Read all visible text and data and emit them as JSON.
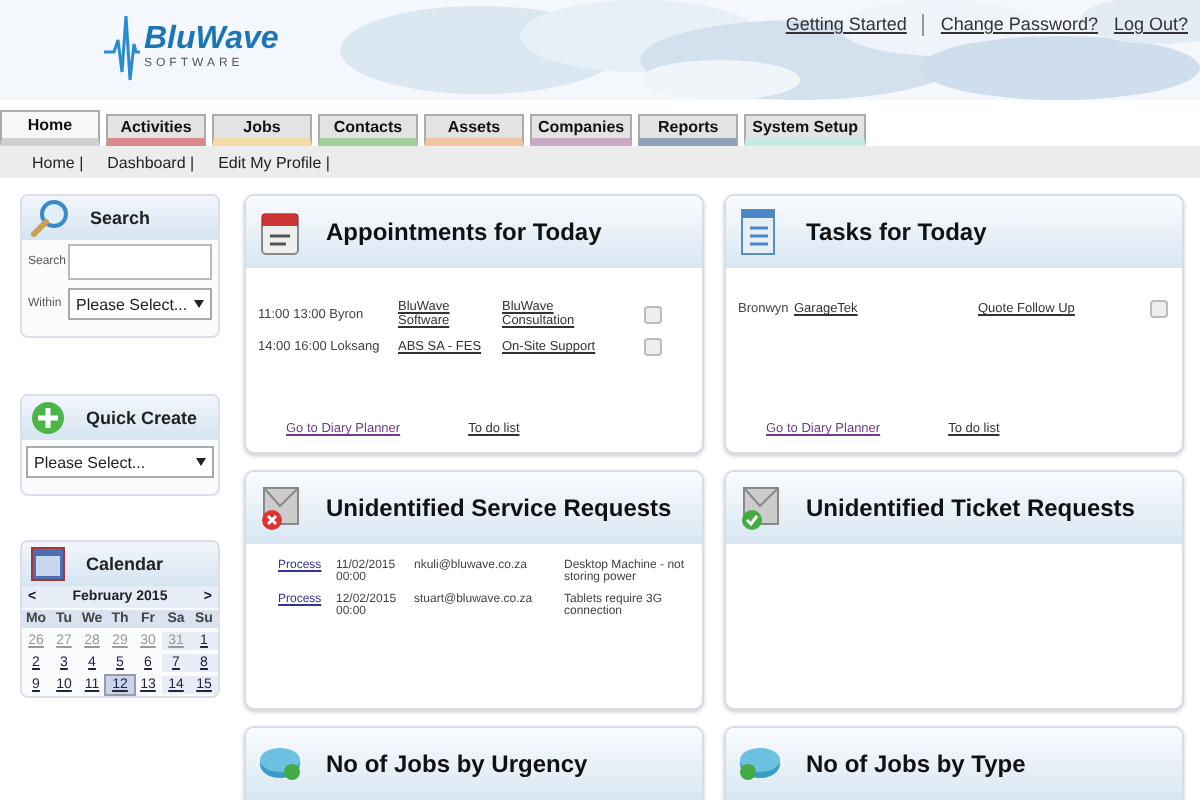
{
  "header": {
    "logo": {
      "name": "BluWave",
      "tagline": "SOFTWARE"
    },
    "links": [
      "Getting Started",
      "Change Password?",
      "Log Out?"
    ]
  },
  "tabs": [
    {
      "label": "Home",
      "selected": true,
      "color": "#d0d0d0"
    },
    {
      "label": "Activities",
      "selected": false,
      "color": "#d98a8a"
    },
    {
      "label": "Jobs",
      "selected": false,
      "color": "#f2dca6"
    },
    {
      "label": "Contacts",
      "selected": false,
      "color": "#a3cf9a"
    },
    {
      "label": "Assets",
      "selected": false,
      "color": "#f1c4a6"
    },
    {
      "label": "Companies",
      "selected": false,
      "color": "#c9aac4"
    },
    {
      "label": "Reports",
      "selected": false,
      "color": "#8ea3b8"
    },
    {
      "label": "System Setup",
      "selected": false,
      "color": "#c4ece2"
    }
  ],
  "subnav": [
    "Home |",
    "Dashboard |",
    "Edit My Profile |"
  ],
  "sidebar": {
    "search": {
      "title": "Search",
      "search_label": "Search",
      "within_label": "Within",
      "within_value": "Please Select..."
    },
    "quick_create": {
      "title": "Quick Create",
      "value": "Please Select..."
    },
    "calendar": {
      "title": "Calendar",
      "prev": "<",
      "month": "February 2015",
      "next": ">",
      "weekdays": [
        "Mo",
        "Tu",
        "We",
        "Th",
        "Fr",
        "Sa",
        "Su"
      ],
      "weeks": [
        [
          {
            "day": "26",
            "other_month": true,
            "selected": false
          },
          {
            "day": "27",
            "other_month": true,
            "selected": false
          },
          {
            "day": "28",
            "other_month": true,
            "selected": false
          },
          {
            "day": "29",
            "other_month": true,
            "selected": false
          },
          {
            "day": "30",
            "other_month": true,
            "selected": false
          },
          {
            "day": "31",
            "other_month": true,
            "selected": false
          },
          {
            "day": "1",
            "other_month": false,
            "selected": false
          }
        ],
        [
          {
            "day": "2",
            "other_month": false,
            "selected": false
          },
          {
            "day": "3",
            "other_month": false,
            "selected": false
          },
          {
            "day": "4",
            "other_month": false,
            "selected": false
          },
          {
            "day": "5",
            "other_month": false,
            "selected": false
          },
          {
            "day": "6",
            "other_month": false,
            "selected": false
          },
          {
            "day": "7",
            "other_month": false,
            "selected": false
          },
          {
            "day": "8",
            "other_month": false,
            "selected": false
          }
        ],
        [
          {
            "day": "9",
            "other_month": false,
            "selected": false
          },
          {
            "day": "10",
            "other_month": false,
            "selected": false
          },
          {
            "day": "11",
            "other_month": false,
            "selected": false
          },
          {
            "day": "12",
            "other_month": false,
            "selected": true
          },
          {
            "day": "13",
            "other_month": false,
            "selected": false
          },
          {
            "day": "14",
            "other_month": false,
            "selected": false
          },
          {
            "day": "15",
            "other_month": false,
            "selected": false
          }
        ]
      ]
    }
  },
  "panels": [
    {
      "kind": "appointments",
      "title": "Appointments for Today",
      "rows": [
        {
          "time": "11:00 13:00 Byron",
          "company": "BluWave Software",
          "subject": "BluWave Consultation",
          "checked": false
        },
        {
          "time": "14:00 16:00 Loksang",
          "company": "ABS SA - FES",
          "subject": "On-Site Support",
          "checked": false
        }
      ],
      "links": [
        "Go to Diary Planner",
        "To do list"
      ]
    },
    {
      "kind": "tasks",
      "title": "Tasks for Today",
      "rows": [
        {
          "time": "Bronwyn",
          "company": "GarageTek",
          "subject": "Quote Follow Up",
          "checked": false
        }
      ],
      "links": [
        "Go to Diary Planner",
        "To do list"
      ]
    },
    {
      "kind": "service",
      "title": "Unidentified Service Requests",
      "requests": [
        {
          "action": "Process",
          "date": "11/02/2015 00:00",
          "email": "nkuli@bluwave.co.za",
          "description": "Desktop Machine - not storing power"
        },
        {
          "action": "Process",
          "date": "12/02/2015 00:00",
          "email": "stuart@bluwave.co.za",
          "description": "Tablets require 3G connection"
        }
      ]
    },
    {
      "kind": "ticket",
      "title": "Unidentified Ticket Requests"
    },
    {
      "kind": "urgency",
      "title": "No of Jobs by Urgency"
    },
    {
      "kind": "type",
      "title": "No of Jobs by Type"
    }
  ]
}
